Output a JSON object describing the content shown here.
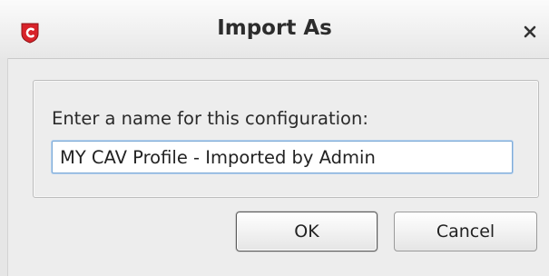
{
  "window": {
    "title": "Import As",
    "app_icon": "comodo-shield-icon",
    "close_icon": "close-icon"
  },
  "form": {
    "prompt": "Enter a name for this configuration:",
    "name_value": "MY CAV Profile - Imported by Admin"
  },
  "buttons": {
    "ok_label": "OK",
    "cancel_label": "Cancel"
  },
  "colors": {
    "accent_red": "#d8232a",
    "input_focus": "#7eabd7"
  }
}
